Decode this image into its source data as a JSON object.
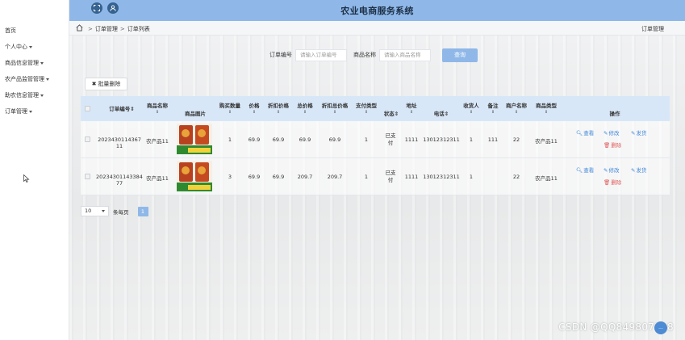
{
  "app": {
    "title": "农业电商服务系统"
  },
  "sidebar": {
    "items": [
      {
        "label": "首页",
        "caret": false
      },
      {
        "label": "个人中心",
        "caret": true
      },
      {
        "label": "商品信息管理",
        "caret": true
      },
      {
        "label": "农产品监管管理",
        "caret": true
      },
      {
        "label": "助农信息管理",
        "caret": true
      },
      {
        "label": "订单管理",
        "caret": true
      }
    ]
  },
  "breadcrumb": {
    "level1": "订单管理",
    "level2": "订单列表",
    "right": "订单管理"
  },
  "search": {
    "order_no_label": "订单编号",
    "order_no_placeholder": "请输入订单编号",
    "product_label": "商品名称",
    "product_placeholder": "请输入商品名称",
    "button": "查询"
  },
  "toolbar": {
    "batch_delete": "批量删除"
  },
  "table": {
    "headers": {
      "order_no": "订单编号",
      "product_name": "商品名称",
      "product_image": "商品图片",
      "quantity": "购买数量",
      "price": "价格",
      "discount_price": "折扣价格",
      "total_price": "总价格",
      "discount_total": "折扣总价格",
      "pay_type": "支付类型",
      "status": "状态",
      "address": "地址",
      "phone": "电话",
      "receiver": "收货人",
      "remark": "备注",
      "merchant": "商户名称",
      "product_type": "商品类型",
      "actions": "操作"
    },
    "sort_glyph": "⇕",
    "rows": [
      {
        "order_no": "2023430114367​11",
        "product_name": "农产品11",
        "quantity": "1",
        "price": "69.9",
        "discount_price": "69.9",
        "total_price": "69.9",
        "discount_total": "69.9",
        "pay_type": "1",
        "status": "已支付",
        "address": "1111",
        "phone": "13012312311",
        "receiver": "1",
        "remark": "111",
        "merchant": "22",
        "product_type": "农产品11"
      },
      {
        "order_no": "20234301143384​77",
        "product_name": "农产品11",
        "quantity": "3",
        "price": "69.9",
        "discount_price": "69.9",
        "total_price": "209.7",
        "discount_total": "209.7",
        "pay_type": "1",
        "status": "已支付",
        "address": "1111",
        "phone": "13012312311",
        "receiver": "1",
        "remark": "",
        "merchant": "22",
        "product_type": "农产品11"
      }
    ],
    "actions": {
      "view": "查看",
      "edit": "修改",
      "ship": "发货",
      "delete": "删除"
    }
  },
  "pagination": {
    "page_size": "10",
    "per_page_label": "条每页",
    "current_page": "1"
  },
  "watermark": "CSDN @QQ849807118",
  "fab": "...",
  "colors": {
    "header": "#8fb8e8",
    "table_header": "#d8e7f8",
    "link_blue": "#3f87d9",
    "danger": "#e15b5b"
  }
}
